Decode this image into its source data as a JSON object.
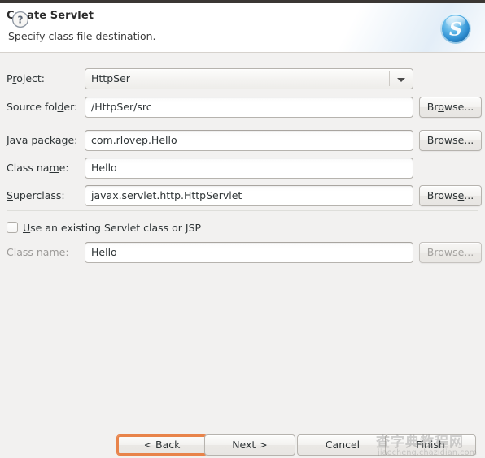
{
  "window": {
    "title": "Create Servlet",
    "subtitle": "Specify class file destination.",
    "banner_icon": "servlet-sphere-icon"
  },
  "form": {
    "project": {
      "label_before": "P",
      "label_mnemonic": "r",
      "label_after": "oject:",
      "value": "HttpSer",
      "control": "combobox"
    },
    "source_folder": {
      "label_before": "Source fol",
      "label_mnemonic": "d",
      "label_after": "er:",
      "value": "/HttpSer/src",
      "browse_before": "Br",
      "browse_mnemonic": "o",
      "browse_after": "wse..."
    },
    "java_package": {
      "label_before": "Java pac",
      "label_mnemonic": "k",
      "label_after": "age:",
      "value": "com.rlovep.Hello",
      "browse_before": "Bro",
      "browse_mnemonic": "w",
      "browse_after": "se..."
    },
    "class_name": {
      "label_before": "Class na",
      "label_mnemonic": "m",
      "label_after": "e:",
      "value": "Hello"
    },
    "superclass": {
      "label_before": "",
      "label_mnemonic": "S",
      "label_after": "uperclass:",
      "value": "javax.servlet.http.HttpServlet",
      "browse_before": "Brows",
      "browse_mnemonic": "e",
      "browse_after": "..."
    },
    "use_existing": {
      "checked": false,
      "label_before": "",
      "label_mnemonic": "U",
      "label_after": "se an existing Servlet class or JSP"
    },
    "existing_class_name": {
      "label_before": "Class na",
      "label_mnemonic": "m",
      "label_after": "e:",
      "value": "Hello",
      "disabled": true,
      "browse_before": "Bro",
      "browse_mnemonic": "w",
      "browse_after": "se...",
      "browse_disabled": true
    }
  },
  "footer": {
    "help_icon": "help-question-icon",
    "buttons": [
      {
        "label": "< Back",
        "name": "back-button",
        "focused": true,
        "disabled": false
      },
      {
        "label": "Next >",
        "name": "next-button",
        "focused": false,
        "disabled": false
      },
      {
        "label": "Cancel",
        "name": "cancel-button",
        "focused": false,
        "disabled": false
      },
      {
        "label": "Finish",
        "name": "finish-button",
        "focused": false,
        "disabled": false
      }
    ]
  },
  "watermark": {
    "line1": "查字典教程网",
    "line2": "jiaocheng.chazidian.com"
  },
  "colors": {
    "focus_ring": "#e8834a",
    "body_bg": "#f2f1f0",
    "header_bg": "#ffffff",
    "accent_blue": "#2b93d4"
  }
}
